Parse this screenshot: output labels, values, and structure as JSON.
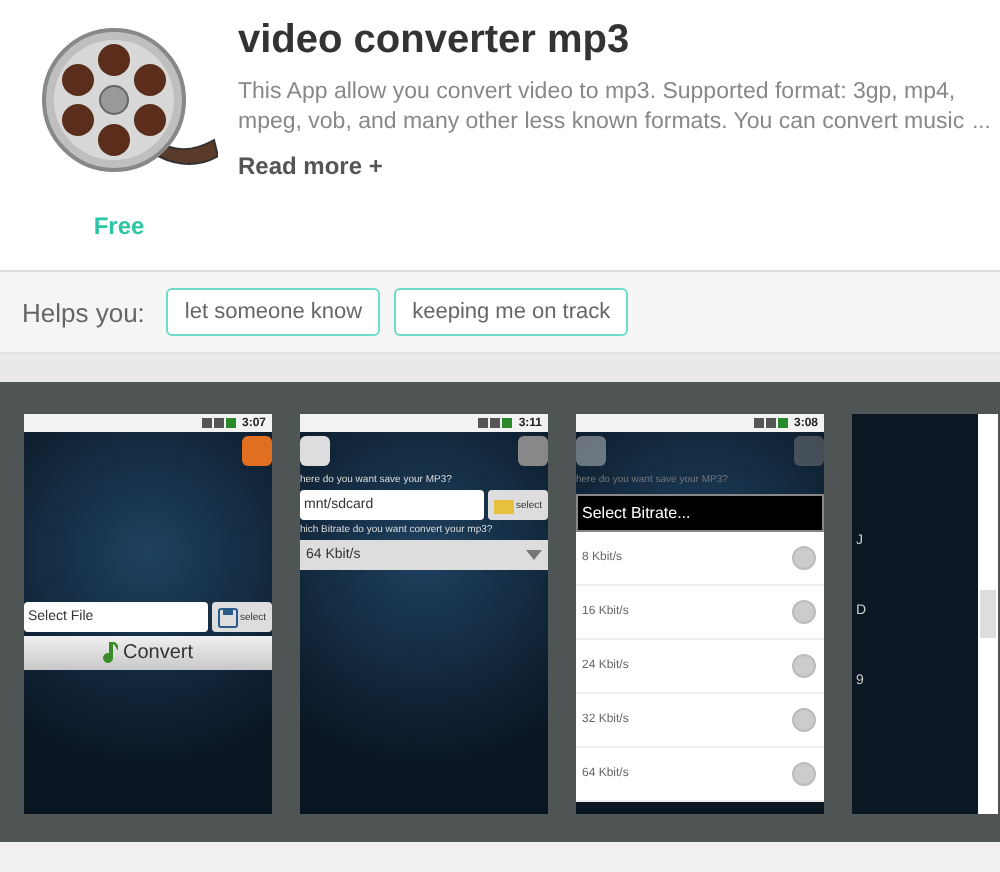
{
  "app": {
    "title": "video converter mp3",
    "description_lines": [
      "This App allow you convert video to mp3. Supported format: 3gp, mp4,",
      "mpeg, vob, and many other less known formats. You can convert music"
    ],
    "more_mark": "...",
    "read_more": "Read more +",
    "price": "Free"
  },
  "helps": {
    "label": "Helps you:",
    "tags": [
      "let someone know",
      "keeping me on track"
    ]
  },
  "screenshots": [
    {
      "kind": "main",
      "time": "3:07",
      "select_field": "Select File",
      "select_button": "select",
      "convert_button": "Convert"
    },
    {
      "kind": "settings",
      "time": "3:11",
      "save_label": "here do you want save your MP3?",
      "path": "mnt/sdcard",
      "select_button": "select",
      "bitrate_label": "hich Bitrate do you want convert your mp3?",
      "bitrate": "64 Kbit/s"
    },
    {
      "kind": "dialog",
      "time": "3:08",
      "save_label": "here do you want save your MP3?",
      "dialog_title": "Select Bitrate...",
      "options": [
        {
          "label": "8 Kbit/s",
          "selected": false
        },
        {
          "label": "16 Kbit/s",
          "selected": false
        },
        {
          "label": "24 Kbit/s",
          "selected": false
        },
        {
          "label": "32 Kbit/s",
          "selected": false
        },
        {
          "label": "64 Kbit/s",
          "selected": false
        }
      ]
    },
    {
      "kind": "partial",
      "letters": [
        "J",
        "D",
        "9"
      ]
    }
  ]
}
